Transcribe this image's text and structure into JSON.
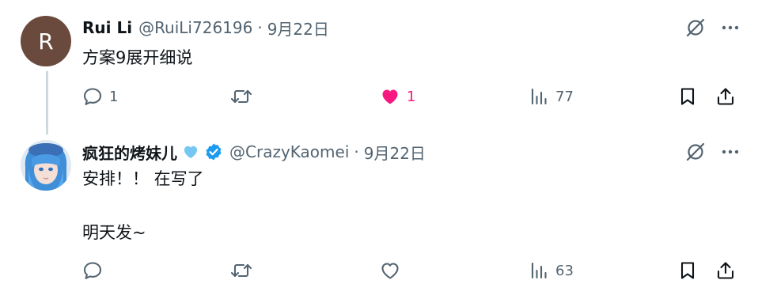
{
  "tweets": [
    {
      "avatar_letter": "R",
      "display_name": "Rui Li",
      "handle": "@RuiLi726196",
      "separator": "·",
      "date": "9月22日",
      "text": "方案9展开细说",
      "reply_count": "1",
      "retweet_count": "",
      "like_count": "1",
      "views_count": "77",
      "liked": true
    },
    {
      "display_name": "疯狂的烤妹儿",
      "handle": "@CrazyKaomei",
      "separator": "·",
      "date": "9月22日",
      "text": "安排！！ 在写了\n\n明天发~",
      "reply_count": "",
      "retweet_count": "",
      "like_count": "",
      "views_count": "63",
      "liked": false,
      "verified": true
    }
  ],
  "colors": {
    "text_secondary": "#536471",
    "like_active": "#f91880",
    "verified_blue": "#1d9bf0",
    "heart_badge": "#74c7f2",
    "thread_line": "#cfd9de"
  },
  "icons": {
    "grok": "grok-icon",
    "more": "more-icon",
    "reply": "reply-icon",
    "retweet": "retweet-icon",
    "like": "heart-icon",
    "views": "views-icon",
    "bookmark": "bookmark-icon",
    "share": "share-icon"
  }
}
